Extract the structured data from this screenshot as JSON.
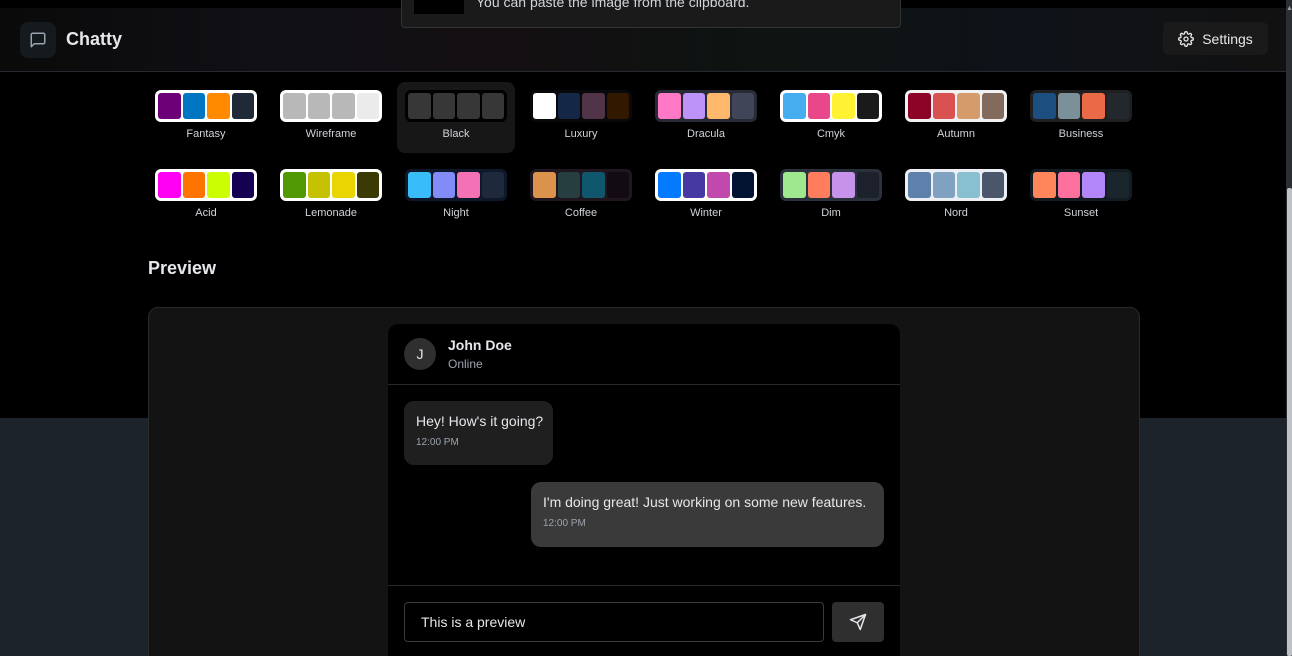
{
  "header": {
    "brand": "Chatty",
    "settings_label": "Settings",
    "toast_text": "You can paste the image from the clipboard."
  },
  "themes": [
    {
      "label": "Fantasy",
      "colors": [
        "#6d0076",
        "#0075c2",
        "#ff8a00",
        "#1f2937"
      ],
      "bg": "#ffffff",
      "selected": false
    },
    {
      "label": "Wireframe",
      "colors": [
        "#b8b8b8",
        "#b8b8b8",
        "#b8b8b8",
        "#ebebeb"
      ],
      "bg": "#ffffff",
      "selected": false
    },
    {
      "label": "Black",
      "colors": [
        "#373737",
        "#373737",
        "#373737",
        "#373737"
      ],
      "bg": "#000000",
      "selected": true
    },
    {
      "label": "Luxury",
      "colors": [
        "#ffffff",
        "#152747",
        "#513448",
        "#331800"
      ],
      "bg": "#09090b",
      "selected": false
    },
    {
      "label": "Dracula",
      "colors": [
        "#ff79c6",
        "#bd93f9",
        "#ffb86c",
        "#414558"
      ],
      "bg": "#282a36",
      "selected": false
    },
    {
      "label": "Cmyk",
      "colors": [
        "#45aeee",
        "#e8488a",
        "#fff232",
        "#1a1a1a"
      ],
      "bg": "#ffffff",
      "selected": false
    },
    {
      "label": "Autumn",
      "colors": [
        "#8c0327",
        "#d85251",
        "#d59b6a",
        "#826a5c"
      ],
      "bg": "#f1f1f1",
      "selected": false
    },
    {
      "label": "Business",
      "colors": [
        "#1c4e80",
        "#7c909a",
        "#ea6947",
        "#23282e"
      ],
      "bg": "#202020",
      "selected": false
    },
    {
      "label": "Acid",
      "colors": [
        "#ff00f4",
        "#ff7400",
        "#cbfd03",
        "#140152"
      ],
      "bg": "#ffffff",
      "selected": false
    },
    {
      "label": "Lemonade",
      "colors": [
        "#519903",
        "#c4c202",
        "#e9d501",
        "#3b3a05"
      ],
      "bg": "#ffffff",
      "selected": false
    },
    {
      "label": "Night",
      "colors": [
        "#38bdf8",
        "#818cf8",
        "#f471b5",
        "#1e293b"
      ],
      "bg": "#0f172a",
      "selected": false
    },
    {
      "label": "Coffee",
      "colors": [
        "#db924b",
        "#263e3f",
        "#10576d",
        "#120c12"
      ],
      "bg": "#20161f",
      "selected": false
    },
    {
      "label": "Winter",
      "colors": [
        "#047aff",
        "#463aa2",
        "#c148ac",
        "#021431"
      ],
      "bg": "#ffffff",
      "selected": false
    },
    {
      "label": "Dim",
      "colors": [
        "#9fe88d",
        "#ff7d5c",
        "#c792e9",
        "#1c212b"
      ],
      "bg": "#2a303c",
      "selected": false
    },
    {
      "label": "Nord",
      "colors": [
        "#5e81ac",
        "#81a1c1",
        "#88c0d0",
        "#4c566a"
      ],
      "bg": "#eceff4",
      "selected": false
    },
    {
      "label": "Sunset",
      "colors": [
        "#ff865b",
        "#fd6f9c",
        "#b387fa",
        "#1b262c"
      ],
      "bg": "#121c22",
      "selected": false
    }
  ],
  "preview": {
    "title": "Preview",
    "contact_initial": "J",
    "contact_name": "John Doe",
    "contact_status": "Online",
    "messages": [
      {
        "text": "Hey! How's it going?",
        "time": "12:00 PM"
      },
      {
        "text": "I'm doing great! Just working on some new features.",
        "time": "12:00 PM"
      }
    ],
    "input_value": "This is a preview"
  },
  "icons": {
    "logo": "message-square-icon",
    "settings": "gear-icon",
    "send": "send-icon"
  }
}
